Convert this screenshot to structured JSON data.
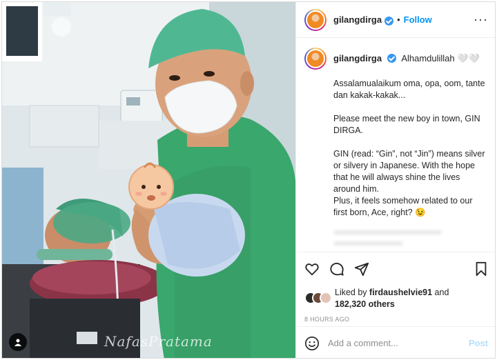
{
  "post": {
    "photo_alt": "Father in green scrubs holding newborn baby in operating room",
    "watermark": "NafasPratama"
  },
  "header": {
    "username": "gilangdirga",
    "separator": "•",
    "follow_label": "Follow",
    "more_label": "···"
  },
  "caption": {
    "username": "gilangdirga",
    "headline": "Alhamdulillah",
    "emoji": "🤍🤍",
    "paragraphs": [
      "Assalamualaikum oma, opa, oom, tante dan kakak-kakak...",
      "Please meet the new boy in town, GIN DIRGA.",
      "GIN (read: “Gin”, not “Jin”) means silver or silvery in Japanese. With the hope that he will always shine the lives around him.\nPlus, it feels somehow related to our first born, Ace, right? 😉"
    ]
  },
  "actions": {
    "icons": [
      "heart-icon",
      "comment-icon",
      "share-icon",
      "bookmark-icon"
    ]
  },
  "likes": {
    "prefix": "Liked by",
    "user": "firdaushelvie91",
    "connector": "and",
    "count": "182,320",
    "suffix": "others"
  },
  "timestamp": "8 HOURS AGO",
  "comment": {
    "placeholder": "Add a comment...",
    "post_label": "Post"
  },
  "colors": {
    "accent": "#0095f6",
    "verified": "#3897f0",
    "scrubs": "#3aa76d"
  }
}
